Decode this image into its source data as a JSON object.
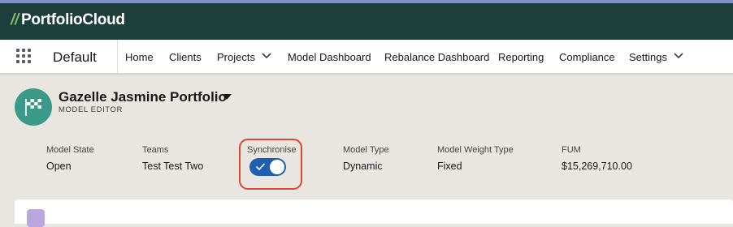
{
  "brand": {
    "slash": "//",
    "name": "PortfolioCloud"
  },
  "nav": {
    "app_name": "Default",
    "items": [
      {
        "label": "Home"
      },
      {
        "label": "Clients"
      },
      {
        "label": "Projects",
        "has_menu": true
      },
      {
        "label": "Model Dashboard"
      },
      {
        "label": "Rebalance Dashboard"
      },
      {
        "label": "Reporting"
      },
      {
        "label": "Compliance"
      },
      {
        "label": "Settings",
        "has_menu": true
      }
    ]
  },
  "record": {
    "title": "Gazelle Jasmine Portfolio",
    "subtitle": "MODEL EDITOR",
    "icon": "checkered-flag-icon",
    "fields": [
      {
        "label": "Model State",
        "value": "Open"
      },
      {
        "label": "Teams",
        "value": "Test Test Two"
      },
      {
        "label": "Synchronise",
        "toggle_on": true
      },
      {
        "label": "Model Type",
        "value": "Dynamic"
      },
      {
        "label": "Model Weight Type",
        "value": "Fixed"
      },
      {
        "label": "FUM",
        "value": "$15,269,710.00"
      }
    ]
  },
  "colors": {
    "brand_bar": "#1d3f3c",
    "logo_slash": "#8ab76a",
    "record_icon": "#3a9a8a",
    "toggle_on": "#1f5fb0",
    "highlight": "#d9492f"
  }
}
